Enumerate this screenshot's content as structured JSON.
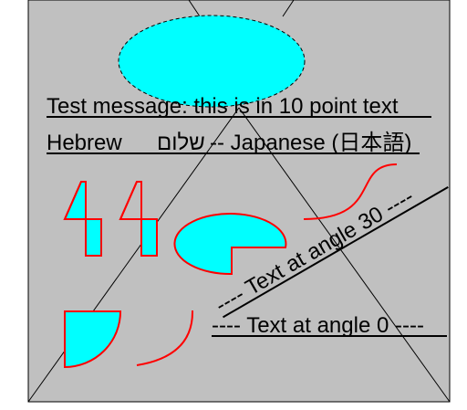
{
  "colors": {
    "page_background": "#ffffff",
    "panel_fill": "#c0c0c0",
    "shape_fill": "#00ffff",
    "red_stroke": "#ff0000",
    "line": "#000000"
  },
  "texts": {
    "test_message": "Test message: this is in 10 point text",
    "hebrew_label": "Hebrew",
    "hebrew_word": "שלום",
    "japanese_part": "-- Japanese (日本語)",
    "angle30_text": "---- Text at angle 30 ----",
    "angle0_text": "---- Text at angle 0 ----"
  }
}
